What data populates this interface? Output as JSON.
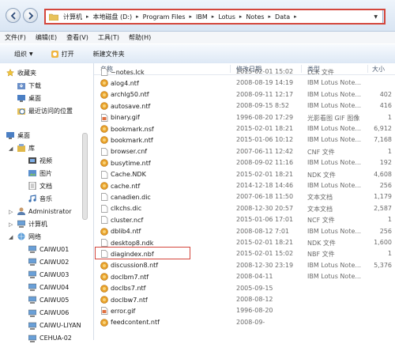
{
  "address_bar": {
    "crumbs": [
      "计算机",
      "本地磁盘 (D:)",
      "Program Files",
      "IBM",
      "Lotus",
      "Notes",
      "Data"
    ]
  },
  "menu": [
    "文件(F)",
    "编辑(E)",
    "查看(V)",
    "工具(T)",
    "帮助(H)"
  ],
  "toolbar": {
    "organize": "组织",
    "open": "打开",
    "new_folder": "新建文件夹"
  },
  "columns": {
    "name": "名称",
    "date": "修改日期",
    "type": "类型",
    "size": "大小"
  },
  "nav": {
    "favorites": "收藏夹",
    "downloads": "下载",
    "desktop_fav": "桌面",
    "recent": "最近访问的位置",
    "desktop": "桌面",
    "library": "库",
    "videos": "视频",
    "pictures": "图片",
    "documents": "文档",
    "music": "音乐",
    "admin": "Administrator",
    "computer": "计算机",
    "network": "网络",
    "hosts": [
      "CAIWU01",
      "CAIWU02",
      "CAIWU03",
      "CAIWU04",
      "CAIWU05",
      "CAIWU06",
      "CAIWU-LIYAN",
      "CEHUA-02"
    ]
  },
  "files": [
    {
      "name": "~notes.lck",
      "date": "2015-02-01 15:02",
      "type": "LCK 文件",
      "size": "",
      "icon": "doc"
    },
    {
      "name": "alog4.ntf",
      "date": "2008-08-19 14:19",
      "type": "IBM Lotus Note...",
      "size": "",
      "icon": "lotus"
    },
    {
      "name": "archlg50.ntf",
      "date": "2008-09-11 12:17",
      "type": "IBM Lotus Note...",
      "size": "402",
      "icon": "lotus"
    },
    {
      "name": "autosave.ntf",
      "date": "2008-09-15 8:52",
      "type": "IBM Lotus Note...",
      "size": "416",
      "icon": "lotus"
    },
    {
      "name": "binary.gif",
      "date": "1996-08-20 17:29",
      "type": "光影看图 GIF 图像",
      "size": "1",
      "icon": "gif"
    },
    {
      "name": "bookmark.nsf",
      "date": "2015-02-01 18:21",
      "type": "IBM Lotus Note...",
      "size": "6,912",
      "icon": "lotus"
    },
    {
      "name": "bookmark.ntf",
      "date": "2015-01-06 10:12",
      "type": "IBM Lotus Note...",
      "size": "7,168",
      "icon": "lotus"
    },
    {
      "name": "browser.cnf",
      "date": "2007-06-11 12:42",
      "type": "CNF 文件",
      "size": "1",
      "icon": "doc"
    },
    {
      "name": "busytime.ntf",
      "date": "2008-09-02 11:16",
      "type": "IBM Lotus Note...",
      "size": "192",
      "icon": "lotus"
    },
    {
      "name": "Cache.NDK",
      "date": "2015-02-01 18:21",
      "type": "NDK 文件",
      "size": "4,608",
      "icon": "doc"
    },
    {
      "name": "cache.ntf",
      "date": "2014-12-18 14:46",
      "type": "IBM Lotus Note...",
      "size": "256",
      "icon": "lotus"
    },
    {
      "name": "canadien.dic",
      "date": "2007-06-18 11:50",
      "type": "文本文档",
      "size": "1,179",
      "icon": "doc"
    },
    {
      "name": "clkchs.dic",
      "date": "2008-12-30 20:57",
      "type": "文本文档",
      "size": "2,587",
      "icon": "doc"
    },
    {
      "name": "cluster.ncf",
      "date": "2015-01-06 17:01",
      "type": "NCF 文件",
      "size": "1",
      "icon": "doc"
    },
    {
      "name": "dblib4.ntf",
      "date": "2008-08-12 7:01",
      "type": "IBM Lotus Note...",
      "size": "256",
      "icon": "lotus"
    },
    {
      "name": "desktop8.ndk",
      "date": "2015-02-01 18:21",
      "type": "NDK 文件",
      "size": "1,600",
      "icon": "doc"
    },
    {
      "name": "diagindex.nbf",
      "date": "2015-02-01 15:02",
      "type": "NBF 文件",
      "size": "1",
      "icon": "doc"
    },
    {
      "name": "discussion8.ntf",
      "date": "2008-12-30 23:19",
      "type": "IBM Lotus Note...",
      "size": "5,376",
      "icon": "lotus"
    },
    {
      "name": "doclbm7.ntf",
      "date": "2008-04-11",
      "type": "IBM Lotus Note...",
      "size": "",
      "icon": "lotus"
    },
    {
      "name": "doclbs7.ntf",
      "date": "2005-09-15",
      "type": "",
      "size": "",
      "icon": "lotus"
    },
    {
      "name": "doclbw7.ntf",
      "date": "2008-08-12",
      "type": "",
      "size": "",
      "icon": "lotus"
    },
    {
      "name": "error.gif",
      "date": "1996-08-20",
      "type": "",
      "size": "",
      "icon": "gif"
    },
    {
      "name": "feedcontent.ntf",
      "date": "2008-09-",
      "type": "",
      "size": "",
      "icon": "lotus"
    }
  ],
  "colors": {
    "highlight": "#d4463c",
    "lotus_icon": "#e8a12a"
  }
}
